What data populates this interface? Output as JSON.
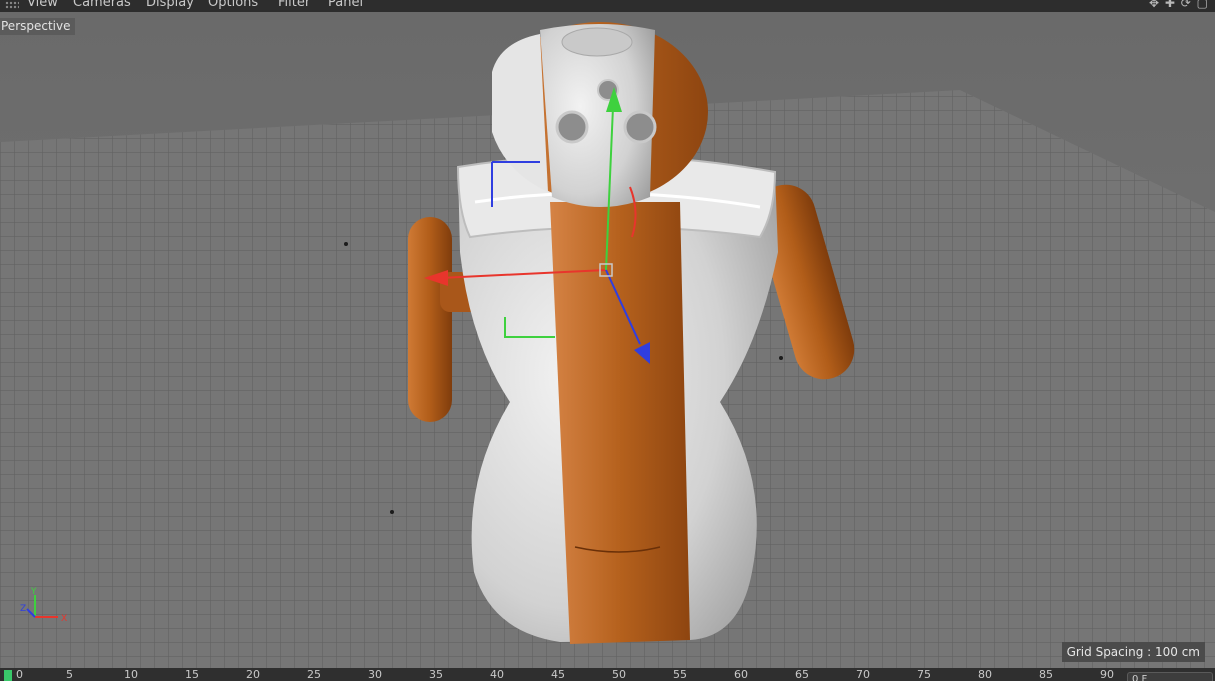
{
  "menu": {
    "items": [
      "View",
      "Cameras",
      "Display",
      "Options",
      "Filter",
      "Panel"
    ],
    "nav_icons": "✥ ✚ ⟳ ▢"
  },
  "viewport": {
    "view_label": "Perspective",
    "grid_spacing": "Grid Spacing : 100 cm",
    "axis_labels": {
      "x": "X",
      "y": "Y",
      "z": "Z"
    }
  },
  "timeline": {
    "frames": [
      "0",
      "5",
      "10",
      "15",
      "20",
      "25",
      "30",
      "35",
      "40",
      "45",
      "50",
      "55",
      "60",
      "65",
      "70",
      "75",
      "80",
      "85",
      "90"
    ],
    "current_frame": "0 F"
  },
  "colors": {
    "viewport_bg": "#6f6f6f",
    "grid_floor": "#747474",
    "robot_white": "#d9d9d9",
    "robot_orange": "#b35e1a",
    "axis_x": "#e8352c",
    "axis_y": "#3ed13e",
    "axis_z": "#2f3ee0",
    "playhead": "#39c86a"
  }
}
